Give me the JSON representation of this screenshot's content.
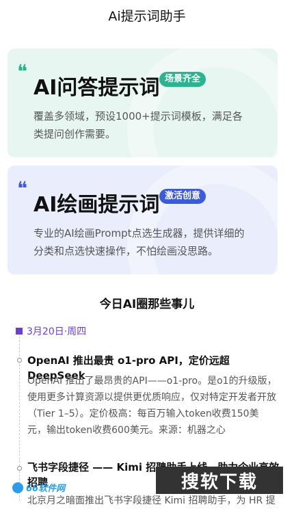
{
  "header": {
    "title": "Ai提示词助手"
  },
  "cards": [
    {
      "title": "AI问答提示词",
      "badge": "场景齐全",
      "desc": "覆盖多领域，预设1000+提示词模板，满足各类提问创作需要。",
      "accent": "#2bb48f"
    },
    {
      "title": "AI绘画提示词",
      "badge": "激活创意",
      "desc": "专业的AI绘画Prompt点选生成器，提供详细的分类和点选快速操作，不怕绘画没思路。",
      "accent": "#3b5bdb"
    }
  ],
  "section": {
    "title": "今日AI圈那些事儿"
  },
  "timeline": {
    "date": "3月20日·周四",
    "items": [
      {
        "title": "OpenAI 推出最贵 o1-pro API，定价远超 DeepSeek",
        "body": "OpenAI 推出了最昂贵的API——o1-pro。是o1的升级版，使用更多计算资源以提供更优质响应，仅对特定开发者开放（Tier 1–5）。定价极高：每百万输入token收费150美元，输出token收费600美元。来源：机器之心"
      },
      {
        "title": "飞书字段捷径 —— Kimi 招聘助手上线，助力企业高效招聘",
        "body": "北京月之暗面推出飞书字段捷径 Kimi 招聘助手，为 HR 提"
      }
    ]
  },
  "watermarks": {
    "left": "66软件网",
    "right": "搜软下载"
  }
}
